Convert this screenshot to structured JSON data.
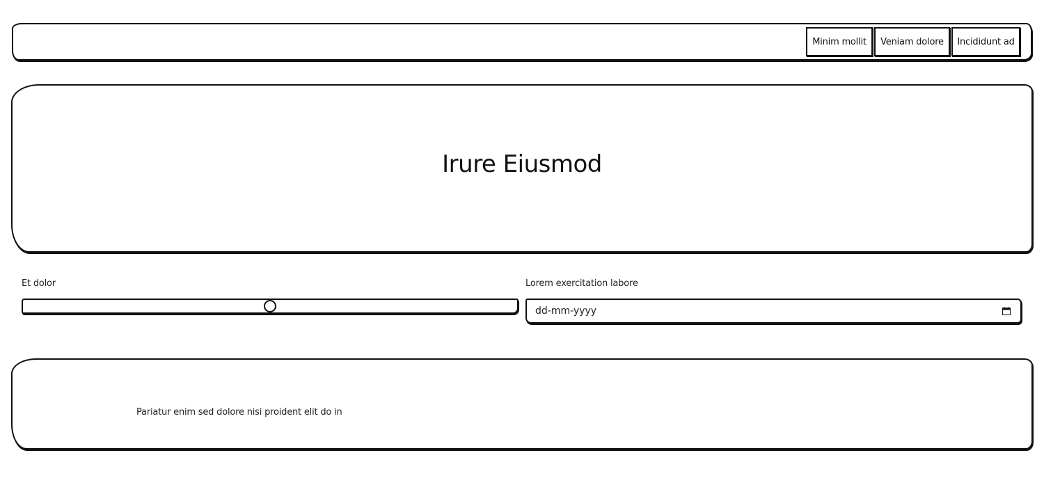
{
  "nav": {
    "items": [
      {
        "label": "Minim mollit"
      },
      {
        "label": "Veniam dolore"
      },
      {
        "label": "Incididunt ad"
      }
    ]
  },
  "hero": {
    "title": "Irure Eiusmod"
  },
  "form": {
    "slider": {
      "label": "Et dolor",
      "value_fraction": 0.5
    },
    "date": {
      "label": "Lorem exercitation labore",
      "placeholder": "dd-mm-yyyy",
      "icon": "calendar-icon"
    }
  },
  "content": {
    "text": "Pariatur enim sed dolore nisi proident elit do in"
  }
}
